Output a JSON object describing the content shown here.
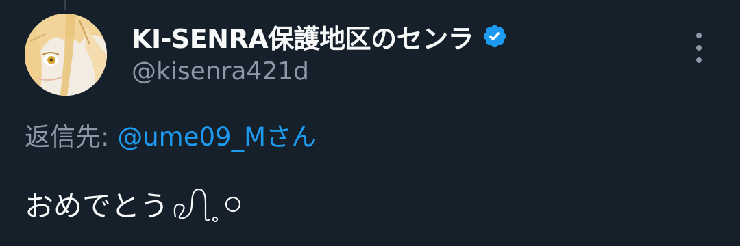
{
  "tweet": {
    "author": {
      "display_name": "KI-SENRA保護地区のセンラ",
      "handle": "@kisenra421d",
      "verified": true
    },
    "reply_to": {
      "prefix": "返信先: ",
      "mention": "@ume09_M",
      "suffix": "さん"
    },
    "text": "おめでとう"
  },
  "icons": {
    "verified": "verified-badge-icon",
    "more": "more-vertical-icon",
    "doodle": "ribbon-doodle-icon"
  },
  "colors": {
    "background": "#15202b",
    "primary_text": "#f7f9f9",
    "secondary_text": "#8b98a5",
    "accent": "#1d9bf0"
  }
}
